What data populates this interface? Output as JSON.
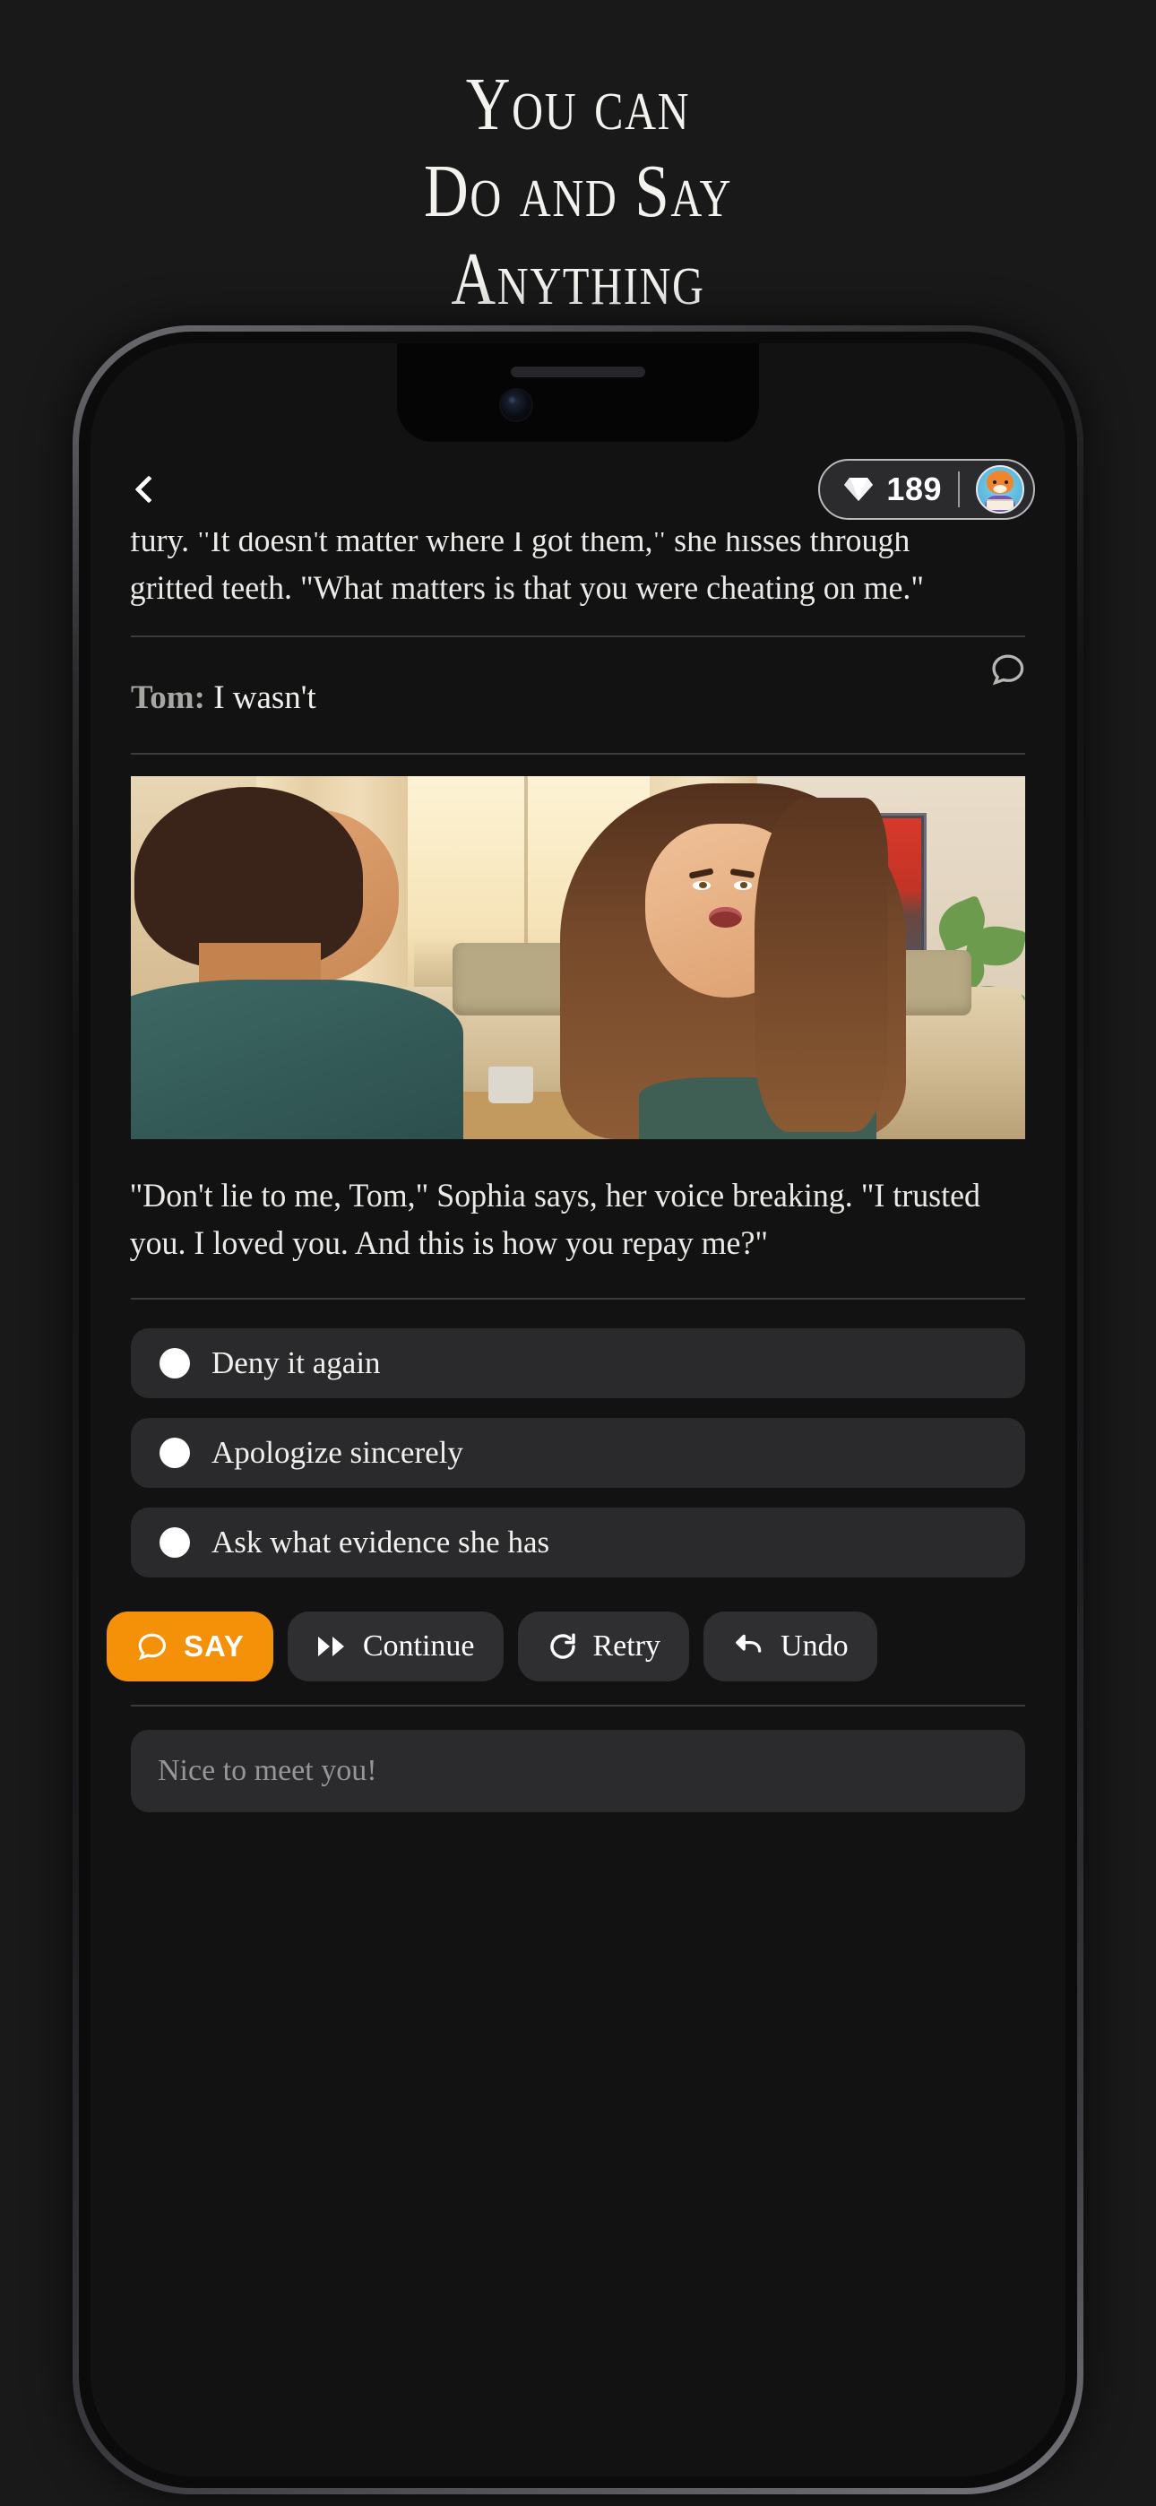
{
  "promo": {
    "headline_lines": [
      "You can",
      "Do and Say",
      "Anything"
    ]
  },
  "app": {
    "header": {
      "back_icon": "chevron-left-icon",
      "gem_icon": "gem-icon",
      "gem_count": "189",
      "avatar_icon": "fox-avatar"
    },
    "story": {
      "previous_paragraph": "fury. \"It doesn't matter where I got them,\" she hisses through gritted teeth. \"What matters is that you were cheating on me.\"",
      "user_turn": {
        "speaker": "Tom:",
        "text": "I wasn't",
        "edit_icon": "speech-bubble-icon"
      },
      "scene_image_alt": "Man facing an upset woman in a sunlit living room",
      "reply_paragraph": "\"Don't lie to me, Tom,\" Sophia says, her voice breaking. \"I trusted you. I loved you. And this is how you repay me?\""
    },
    "choices": [
      {
        "label": "Deny it again"
      },
      {
        "label": "Apologize sincerely"
      },
      {
        "label": "Ask what evidence she has"
      }
    ],
    "toolbar": [
      {
        "label": "SAY",
        "icon": "speech-bubble-icon",
        "accent": "#f59109"
      },
      {
        "label": "Continue",
        "icon": "fast-forward-icon"
      },
      {
        "label": "Retry",
        "icon": "refresh-icon"
      },
      {
        "label": "Undo",
        "icon": "undo-arrow-icon"
      }
    ],
    "input": {
      "placeholder": "Nice to meet you!",
      "value": ""
    }
  },
  "colors": {
    "background": "#1a191a",
    "screen": "#121212",
    "accent": "#f59109",
    "card": "#2a2a2c",
    "text": "#f2f0ed",
    "muted": "#97959a"
  }
}
